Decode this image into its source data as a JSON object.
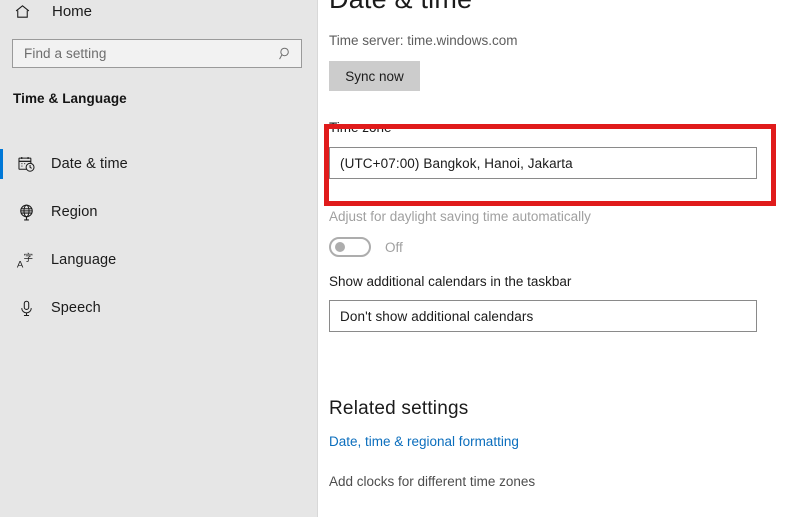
{
  "sidebar": {
    "home": {
      "label": "Home",
      "icon": "home-icon"
    },
    "search": {
      "placeholder": "Find a setting",
      "icon": "search-icon"
    },
    "category": "Time & Language",
    "items": [
      {
        "label": "Date & time",
        "icon": "calendar-clock-icon",
        "selected": true
      },
      {
        "label": "Region",
        "icon": "globe-icon",
        "selected": false
      },
      {
        "label": "Language",
        "icon": "language-icon",
        "selected": false
      },
      {
        "label": "Speech",
        "icon": "microphone-icon",
        "selected": false
      }
    ]
  },
  "main": {
    "title": "Date & time",
    "time_server": "Time server: time.windows.com",
    "sync_button": "Sync now",
    "time_zone": {
      "label": "Time zone",
      "value": "(UTC+07:00) Bangkok, Hanoi, Jakarta"
    },
    "daylight": {
      "label": "Adjust for daylight saving time automatically",
      "state": "Off"
    },
    "calendars": {
      "label": "Show additional calendars in the taskbar",
      "value": "Don't show additional calendars"
    },
    "related": {
      "title": "Related settings",
      "link": "Date, time & regional formatting",
      "text": "Add clocks for different time zones"
    }
  },
  "annotation": {
    "color": "#e01b1b",
    "target": "time-zone-section"
  },
  "colors": {
    "sidebar_bg": "#e6e6e6",
    "content_bg": "#ffffff",
    "accent": "#0078d7",
    "link": "#0b6ebd",
    "annotation": "#e01b1b",
    "disabled_text": "#a0a0a0"
  }
}
